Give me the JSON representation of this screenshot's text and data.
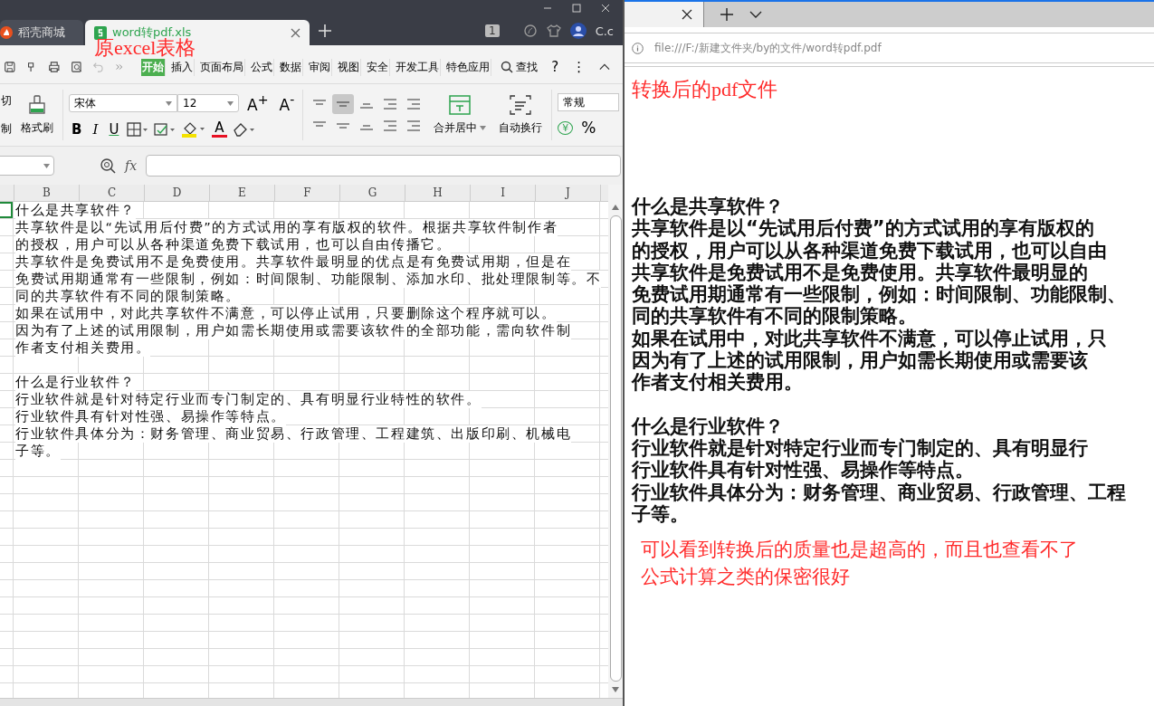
{
  "excel": {
    "tabs": [
      {
        "label": "稻壳商城",
        "selected": false
      },
      {
        "label": "word转pdf.xls",
        "selected": true
      }
    ],
    "tab_count": "1",
    "account": "C.c",
    "annotation": "原excel表格",
    "menu": [
      {
        "label": "开始",
        "selected": true
      },
      {
        "label": "插入",
        "selected": false
      },
      {
        "label": "页面布局",
        "selected": false
      },
      {
        "label": "公式",
        "selected": false
      },
      {
        "label": "数据",
        "selected": false
      },
      {
        "label": "审阅",
        "selected": false
      },
      {
        "label": "视图",
        "selected": false
      },
      {
        "label": "安全",
        "selected": false
      },
      {
        "label": "开发工具",
        "selected": false
      },
      {
        "label": "特色应用",
        "selected": false
      }
    ],
    "find": "查找",
    "help": "?",
    "more": "⋮",
    "ribbon": {
      "cut": "切",
      "copy": "制",
      "format_painter": "格式刷",
      "font": "宋体",
      "size": "12",
      "grow": "A$^{+}$",
      "shrink": "A$^{-}$",
      "bold": "B",
      "italic": "I",
      "underline": "U",
      "font_color": "A",
      "merge": "合并居中",
      "wrap": "自动换行",
      "number_format": "常规",
      "currency": "¥",
      "percent": "%"
    },
    "fx": "fx",
    "columns": [
      "B",
      "C",
      "D",
      "E",
      "F",
      "G",
      "H",
      "I",
      "J"
    ],
    "sections": [
      {
        "rows": [
          {
            "text": "什么是共享软件？",
            "selected": true
          },
          {
            "text": "共享软件是以“先试用后付费”的方式试用的享有版权的软件。根据共享软件制作者",
            "selected": false
          },
          {
            "text": "的授权，用户可以从各种渠道免费下载试用，也可以自由传播它。",
            "selected": false
          },
          {
            "text": "共享软件是免费试用不是免费使用。共享软件最明显的优点是有免费试用期，但是在",
            "selected": false
          },
          {
            "text": "免费试用期通常有一些限制，例如：时间限制、功能限制、添加水印、批处理限制等。不",
            "selected": false
          },
          {
            "text": "同的共享软件有不同的限制策略。",
            "selected": false
          },
          {
            "text": "如果在试用中，对此共享软件不满意，可以停止试用，只要删除这个程序就可以。",
            "selected": false
          },
          {
            "text": "因为有了上述的试用限制，用户如需长期使用或需要该软件的全部功能，需向软件制",
            "selected": false
          },
          {
            "text": "作者支付相关费用。",
            "selected": false
          }
        ]
      },
      {
        "rows": [
          {
            "text": "什么是行业软件？",
            "selected": false
          },
          {
            "text": "行业软件就是针对特定行业而专门制定的、具有明显行业特性的软件。",
            "selected": false
          },
          {
            "text": "行业软件具有针对性强、易操作等特点。",
            "selected": false
          },
          {
            "text": "行业软件具体分为：财务管理、商业贸易、行政管理、工程建筑、出版印刷、机械电",
            "selected": false
          },
          {
            "text": "子等。",
            "selected": false
          }
        ]
      }
    ]
  },
  "browser": {
    "url": "file:///F:/新建文件夹/by的文件/word转pdf.pdf",
    "annotation": "转换后的pdf文件",
    "sections": [
      [
        "什么是共享软件？",
        "共享软件是以“先试用后付费”的方式试用的享有版权的",
        "的授权，用户可以从各种渠道免费下载试用，也可以自由",
        "共享软件是免费试用不是免费使用。共享软件最明显的",
        "免费试用期通常有一些限制，例如：时间限制、功能限制、",
        "同的共享软件有不同的限制策略。",
        "如果在试用中，对此共享软件不满意，可以停止试用，只",
        "因为有了上述的试用限制，用户如需长期使用或需要该",
        "作者支付相关费用。"
      ],
      [
        "什么是行业软件？",
        "行业软件就是针对特定行业而专门制定的、具有明显行",
        "行业软件具有针对性强、易操作等特点。",
        "行业软件具体分为：财务管理、商业贸易、行政管理、工程",
        "子等。"
      ]
    ],
    "note_lines": [
      "可以看到转换后的质量也是超高的，而且也查看不了",
      "公式计算之类的保密很好"
    ]
  }
}
